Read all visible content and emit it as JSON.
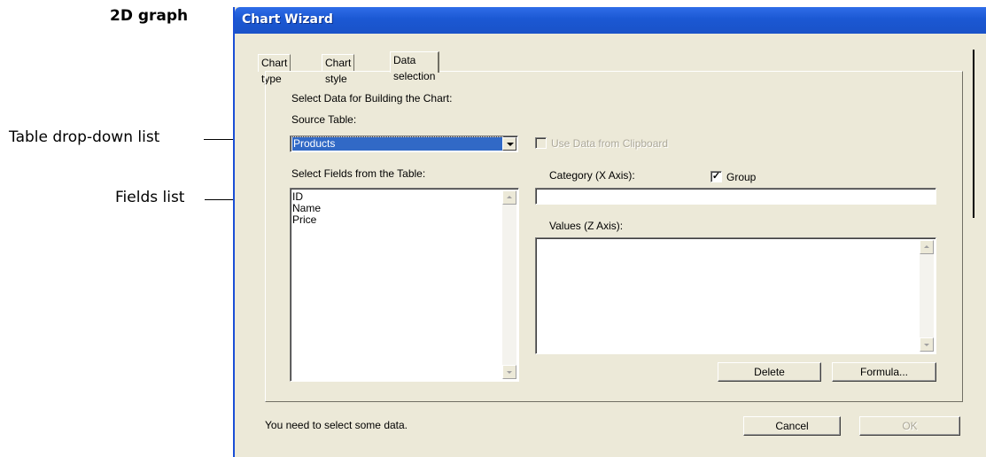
{
  "annotations": {
    "heading": "2D graph",
    "table_dropdown_label": "Table drop-down list",
    "fields_list_label": "Fields list"
  },
  "window": {
    "title": "Chart Wizard"
  },
  "tabs": [
    {
      "label": "Chart type"
    },
    {
      "label": "Chart style"
    },
    {
      "label": "Data selection"
    }
  ],
  "data_selection": {
    "instruction": "Select Data for Building the Chart:",
    "source_table_label": "Source Table:",
    "source_table_value": "Products",
    "use_clipboard_label": "Use Data from Clipboard",
    "select_fields_label": "Select Fields from the Table:",
    "fields": [
      "ID",
      "Name",
      "Price"
    ],
    "category_label": "Category (X Axis):",
    "group_label": "Group",
    "group_checked_mark": "✓",
    "category_value": "",
    "values_label": "Values (Z Axis):",
    "delete_label": "Delete",
    "formula_label": "Formula..."
  },
  "footer": {
    "status": "You need to select some data.",
    "cancel_label": "Cancel",
    "ok_label": "OK"
  },
  "colors": {
    "titlebar": "#1b58d3",
    "dialog_face": "#ece9d8",
    "selection": "#3169c6",
    "disabled_text": "#aca899"
  }
}
